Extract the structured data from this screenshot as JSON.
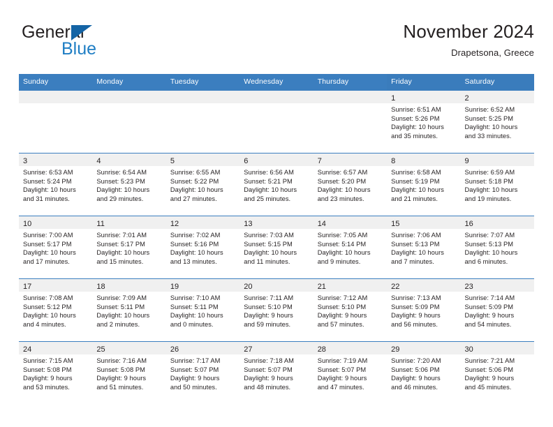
{
  "brand": {
    "name_top": "General",
    "name_bottom": "Blue",
    "triangle_color": "#1464a5",
    "blue_text_color": "#1f7ec4"
  },
  "header": {
    "title": "November 2024",
    "subtitle": "Drapetsona, Greece"
  },
  "theme": {
    "header_blue": "#3b7ebf",
    "daynum_band": "#f0f0f0",
    "text": "#231f20"
  },
  "weekdays": [
    "Sunday",
    "Monday",
    "Tuesday",
    "Wednesday",
    "Thursday",
    "Friday",
    "Saturday"
  ],
  "labels": {
    "sunrise_prefix": "Sunrise:",
    "sunset_prefix": "Sunset:",
    "daylight_prefix": "Daylight:"
  },
  "weeks": [
    [
      {
        "day": "",
        "l1": "",
        "l2": "",
        "l3": "",
        "l4": ""
      },
      {
        "day": "",
        "l1": "",
        "l2": "",
        "l3": "",
        "l4": ""
      },
      {
        "day": "",
        "l1": "",
        "l2": "",
        "l3": "",
        "l4": ""
      },
      {
        "day": "",
        "l1": "",
        "l2": "",
        "l3": "",
        "l4": ""
      },
      {
        "day": "",
        "l1": "",
        "l2": "",
        "l3": "",
        "l4": ""
      },
      {
        "day": "1",
        "l1": "Sunrise: 6:51 AM",
        "l2": "Sunset: 5:26 PM",
        "l3": "Daylight: 10 hours",
        "l4": "and 35 minutes."
      },
      {
        "day": "2",
        "l1": "Sunrise: 6:52 AM",
        "l2": "Sunset: 5:25 PM",
        "l3": "Daylight: 10 hours",
        "l4": "and 33 minutes."
      }
    ],
    [
      {
        "day": "3",
        "l1": "Sunrise: 6:53 AM",
        "l2": "Sunset: 5:24 PM",
        "l3": "Daylight: 10 hours",
        "l4": "and 31 minutes."
      },
      {
        "day": "4",
        "l1": "Sunrise: 6:54 AM",
        "l2": "Sunset: 5:23 PM",
        "l3": "Daylight: 10 hours",
        "l4": "and 29 minutes."
      },
      {
        "day": "5",
        "l1": "Sunrise: 6:55 AM",
        "l2": "Sunset: 5:22 PM",
        "l3": "Daylight: 10 hours",
        "l4": "and 27 minutes."
      },
      {
        "day": "6",
        "l1": "Sunrise: 6:56 AM",
        "l2": "Sunset: 5:21 PM",
        "l3": "Daylight: 10 hours",
        "l4": "and 25 minutes."
      },
      {
        "day": "7",
        "l1": "Sunrise: 6:57 AM",
        "l2": "Sunset: 5:20 PM",
        "l3": "Daylight: 10 hours",
        "l4": "and 23 minutes."
      },
      {
        "day": "8",
        "l1": "Sunrise: 6:58 AM",
        "l2": "Sunset: 5:19 PM",
        "l3": "Daylight: 10 hours",
        "l4": "and 21 minutes."
      },
      {
        "day": "9",
        "l1": "Sunrise: 6:59 AM",
        "l2": "Sunset: 5:18 PM",
        "l3": "Daylight: 10 hours",
        "l4": "and 19 minutes."
      }
    ],
    [
      {
        "day": "10",
        "l1": "Sunrise: 7:00 AM",
        "l2": "Sunset: 5:17 PM",
        "l3": "Daylight: 10 hours",
        "l4": "and 17 minutes."
      },
      {
        "day": "11",
        "l1": "Sunrise: 7:01 AM",
        "l2": "Sunset: 5:17 PM",
        "l3": "Daylight: 10 hours",
        "l4": "and 15 minutes."
      },
      {
        "day": "12",
        "l1": "Sunrise: 7:02 AM",
        "l2": "Sunset: 5:16 PM",
        "l3": "Daylight: 10 hours",
        "l4": "and 13 minutes."
      },
      {
        "day": "13",
        "l1": "Sunrise: 7:03 AM",
        "l2": "Sunset: 5:15 PM",
        "l3": "Daylight: 10 hours",
        "l4": "and 11 minutes."
      },
      {
        "day": "14",
        "l1": "Sunrise: 7:05 AM",
        "l2": "Sunset: 5:14 PM",
        "l3": "Daylight: 10 hours",
        "l4": "and 9 minutes."
      },
      {
        "day": "15",
        "l1": "Sunrise: 7:06 AM",
        "l2": "Sunset: 5:13 PM",
        "l3": "Daylight: 10 hours",
        "l4": "and 7 minutes."
      },
      {
        "day": "16",
        "l1": "Sunrise: 7:07 AM",
        "l2": "Sunset: 5:13 PM",
        "l3": "Daylight: 10 hours",
        "l4": "and 6 minutes."
      }
    ],
    [
      {
        "day": "17",
        "l1": "Sunrise: 7:08 AM",
        "l2": "Sunset: 5:12 PM",
        "l3": "Daylight: 10 hours",
        "l4": "and 4 minutes."
      },
      {
        "day": "18",
        "l1": "Sunrise: 7:09 AM",
        "l2": "Sunset: 5:11 PM",
        "l3": "Daylight: 10 hours",
        "l4": "and 2 minutes."
      },
      {
        "day": "19",
        "l1": "Sunrise: 7:10 AM",
        "l2": "Sunset: 5:11 PM",
        "l3": "Daylight: 10 hours",
        "l4": "and 0 minutes."
      },
      {
        "day": "20",
        "l1": "Sunrise: 7:11 AM",
        "l2": "Sunset: 5:10 PM",
        "l3": "Daylight: 9 hours",
        "l4": "and 59 minutes."
      },
      {
        "day": "21",
        "l1": "Sunrise: 7:12 AM",
        "l2": "Sunset: 5:10 PM",
        "l3": "Daylight: 9 hours",
        "l4": "and 57 minutes."
      },
      {
        "day": "22",
        "l1": "Sunrise: 7:13 AM",
        "l2": "Sunset: 5:09 PM",
        "l3": "Daylight: 9 hours",
        "l4": "and 56 minutes."
      },
      {
        "day": "23",
        "l1": "Sunrise: 7:14 AM",
        "l2": "Sunset: 5:09 PM",
        "l3": "Daylight: 9 hours",
        "l4": "and 54 minutes."
      }
    ],
    [
      {
        "day": "24",
        "l1": "Sunrise: 7:15 AM",
        "l2": "Sunset: 5:08 PM",
        "l3": "Daylight: 9 hours",
        "l4": "and 53 minutes."
      },
      {
        "day": "25",
        "l1": "Sunrise: 7:16 AM",
        "l2": "Sunset: 5:08 PM",
        "l3": "Daylight: 9 hours",
        "l4": "and 51 minutes."
      },
      {
        "day": "26",
        "l1": "Sunrise: 7:17 AM",
        "l2": "Sunset: 5:07 PM",
        "l3": "Daylight: 9 hours",
        "l4": "and 50 minutes."
      },
      {
        "day": "27",
        "l1": "Sunrise: 7:18 AM",
        "l2": "Sunset: 5:07 PM",
        "l3": "Daylight: 9 hours",
        "l4": "and 48 minutes."
      },
      {
        "day": "28",
        "l1": "Sunrise: 7:19 AM",
        "l2": "Sunset: 5:07 PM",
        "l3": "Daylight: 9 hours",
        "l4": "and 47 minutes."
      },
      {
        "day": "29",
        "l1": "Sunrise: 7:20 AM",
        "l2": "Sunset: 5:06 PM",
        "l3": "Daylight: 9 hours",
        "l4": "and 46 minutes."
      },
      {
        "day": "30",
        "l1": "Sunrise: 7:21 AM",
        "l2": "Sunset: 5:06 PM",
        "l3": "Daylight: 9 hours",
        "l4": "and 45 minutes."
      }
    ]
  ]
}
